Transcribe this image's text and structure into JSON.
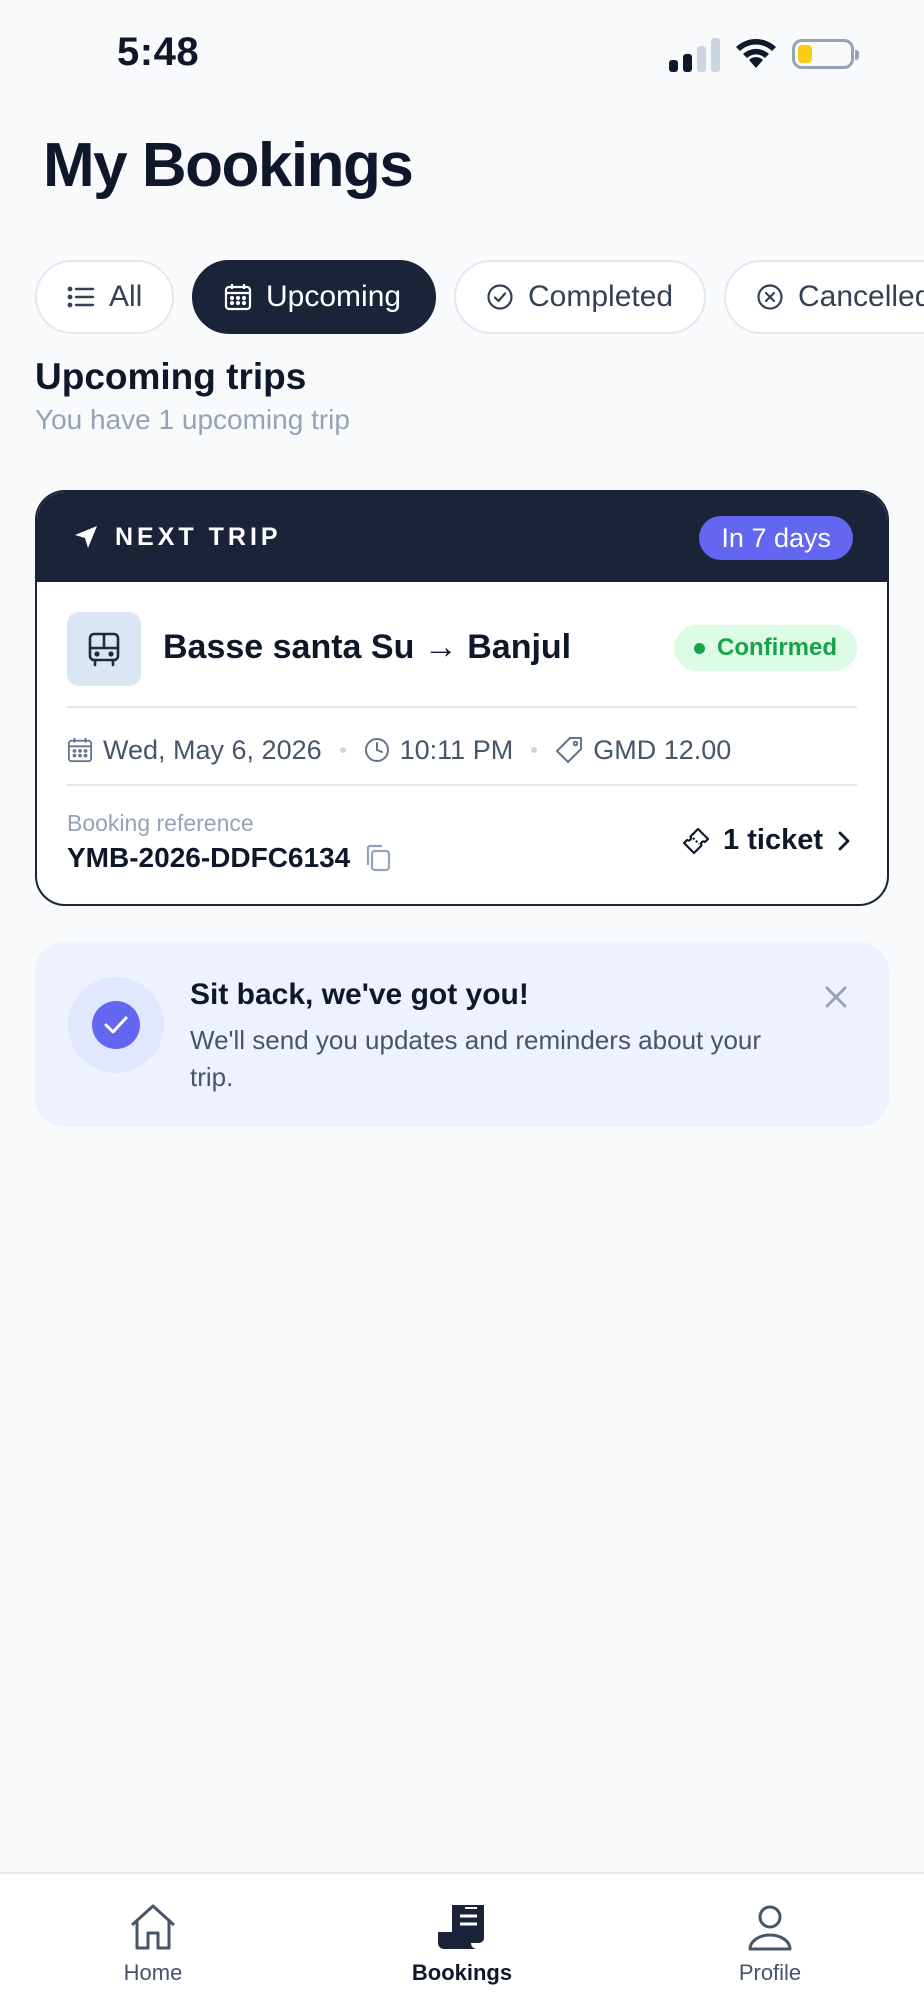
{
  "status_bar": {
    "time": "5:48",
    "icons": [
      "cellular-signal-icon",
      "wifi-icon",
      "battery-icon"
    ]
  },
  "page": {
    "title": "My Bookings"
  },
  "filters": {
    "items": [
      {
        "label": "All",
        "icon": "list-icon",
        "active": false
      },
      {
        "label": "Upcoming",
        "icon": "calendar-icon",
        "active": true
      },
      {
        "label": "Completed",
        "icon": "check-circle-icon",
        "active": false
      },
      {
        "label": "Cancelled",
        "icon": "x-circle-icon",
        "active": false
      }
    ]
  },
  "section": {
    "title": "Upcoming trips",
    "subtitle": "You have 1 upcoming trip"
  },
  "trip_card": {
    "header_label": "NEXT TRIP",
    "countdown": "In 7 days",
    "route": "Basse santa Su → Banjul",
    "status": "Confirmed",
    "date": "Wed, May 6, 2026",
    "time": "10:11 PM",
    "price": "GMD 12.00",
    "reference_label": "Booking reference",
    "reference": "YMB-2026-DDFC6134",
    "tickets": "1 ticket"
  },
  "banner": {
    "title": "Sit back, we've got you!",
    "text": "We'll send you updates and reminders about your trip."
  },
  "bottom_nav": {
    "items": [
      {
        "label": "Home",
        "icon": "home-icon",
        "active": false
      },
      {
        "label": "Bookings",
        "icon": "bookings-icon",
        "active": true
      },
      {
        "label": "Profile",
        "icon": "profile-icon",
        "active": false
      }
    ]
  },
  "colors": {
    "navy": "#1a2338",
    "accent": "#6366f1",
    "success": "#16a34a",
    "success_bg": "#dcfce7",
    "background": "#f8fafc"
  }
}
